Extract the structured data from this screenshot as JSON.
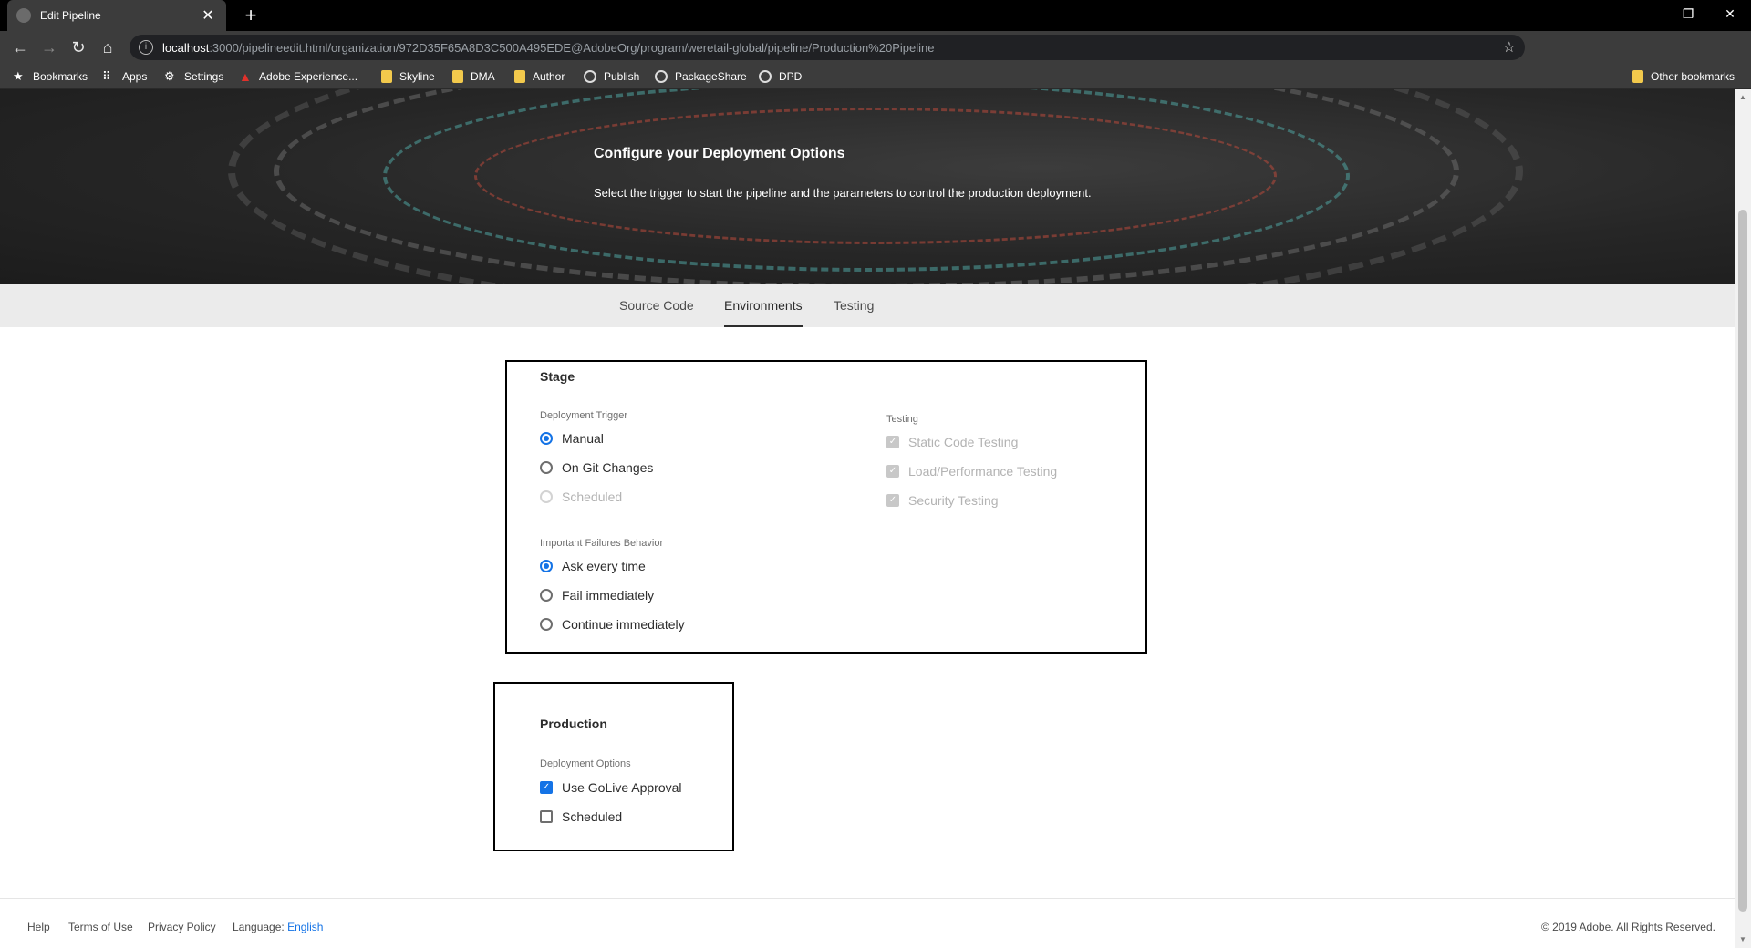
{
  "browser": {
    "tab_title": "Edit Pipeline",
    "new_tab": "+",
    "url_host": "localhost",
    "url_rest": ":3000/pipelineedit.html/organization/972D35F65A8D3C500A495EDE@AdobeOrg/program/weretail-global/pipeline/Production%20Pipeline",
    "bookmarks": [
      {
        "label": "Bookmarks",
        "icon": "star-icon"
      },
      {
        "label": "Apps",
        "icon": "apps-grid-icon"
      },
      {
        "label": "Settings",
        "icon": "gear-icon"
      },
      {
        "label": "Adobe Experience...",
        "icon": "adobe-icon"
      },
      {
        "label": "Skyline",
        "icon": "folder-icon"
      },
      {
        "label": "DMA",
        "icon": "folder-icon"
      },
      {
        "label": "Author",
        "icon": "folder-icon"
      },
      {
        "label": "Publish",
        "icon": "globe-icon"
      },
      {
        "label": "PackageShare",
        "icon": "globe-icon"
      },
      {
        "label": "DPD",
        "icon": "globe-icon"
      }
    ],
    "other_bookmarks": "Other bookmarks"
  },
  "hero": {
    "title": "Configure your Deployment Options",
    "subtitle": "Select the trigger to start the pipeline and the parameters to control the production deployment."
  },
  "tabs": [
    {
      "label": "Source Code",
      "active": false
    },
    {
      "label": "Environments",
      "active": true
    },
    {
      "label": "Testing",
      "active": false
    }
  ],
  "stage": {
    "heading": "Stage",
    "trigger_label": "Deployment Trigger",
    "triggers": [
      {
        "label": "Manual",
        "selected": true,
        "disabled": false
      },
      {
        "label": "On Git Changes",
        "selected": false,
        "disabled": false
      },
      {
        "label": "Scheduled",
        "selected": false,
        "disabled": true
      }
    ],
    "failures_label": "Important Failures Behavior",
    "failures": [
      {
        "label": "Ask every time",
        "selected": true
      },
      {
        "label": "Fail immediately",
        "selected": false
      },
      {
        "label": "Continue immediately",
        "selected": false
      }
    ],
    "testing_label": "Testing",
    "testing": [
      {
        "label": "Static Code Testing",
        "checked": true,
        "disabled": true
      },
      {
        "label": "Load/Performance Testing",
        "checked": true,
        "disabled": true
      },
      {
        "label": "Security Testing",
        "checked": true,
        "disabled": true
      }
    ]
  },
  "production": {
    "heading": "Production",
    "options_label": "Deployment Options",
    "options": [
      {
        "label": "Use GoLive Approval",
        "checked": true
      },
      {
        "label": "Scheduled",
        "checked": false
      }
    ]
  },
  "footer": {
    "help": "Help",
    "terms": "Terms of Use",
    "privacy": "Privacy Policy",
    "language_label": "Language:",
    "language": "English",
    "copyright": "© 2019 Adobe. All Rights Reserved."
  },
  "colors": {
    "accent": "#1473e6",
    "chrome_dark": "#3c3c3c",
    "tab_bar": "#ebebeb"
  }
}
